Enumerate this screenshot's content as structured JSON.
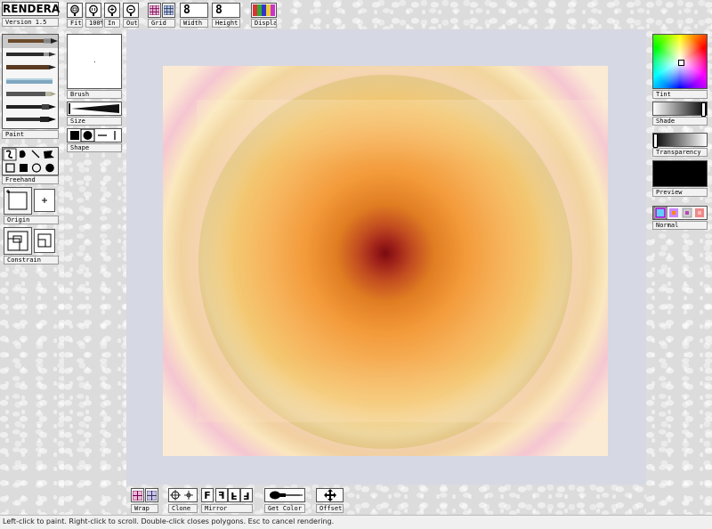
{
  "app": {
    "logo": "RENDERA",
    "version": "Version 1.5"
  },
  "toolbar": {
    "fit": "Fit",
    "zoom100": "100%",
    "zoom_in": "In",
    "zoom_out": "Out",
    "grid": "Grid",
    "width_label": "Width",
    "height_label": "Height",
    "width_value": "8",
    "height_value": "8",
    "display": "Display"
  },
  "left": {
    "paint": "Paint",
    "brush": "Brush",
    "size": "Size",
    "shape": "Shape",
    "freehand": "Freehand",
    "origin": "Origin",
    "constrain": "Constrain"
  },
  "right": {
    "tint": "Tint",
    "shade": "Shade",
    "transparency": "Transparency",
    "preview": "Preview",
    "normal": "Normal"
  },
  "bottom": {
    "wrap": "Wrap",
    "clone": "Clone",
    "mirror": "Mirror",
    "get_color": "Get Color",
    "offset": "Offset"
  },
  "status": "Left-click to paint. Right-click to scroll. Double-click closes polygons. Esc to cancel rendering.",
  "colors": {
    "preview": "#000000",
    "workspace": "#d6d8e3"
  },
  "icons": {
    "fit": "magnifier-fit-icon",
    "zoom100": "magnifier-100-icon",
    "in": "zoom-in-icon",
    "out": "zoom-out-icon",
    "grid": "grid-icon",
    "display": "color-bars-icon",
    "wrap": "wrap-icon",
    "clone": "clone-crosshair-icon",
    "mirror": "mirror-icon",
    "get_color": "eyedropper-icon",
    "offset": "move-arrows-icon"
  }
}
